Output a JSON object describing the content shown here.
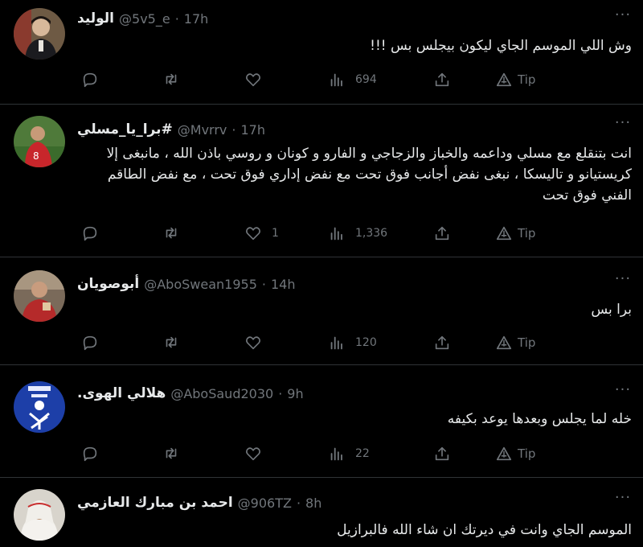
{
  "colors": {
    "background": "#000000",
    "text": "#e7e9ea",
    "muted": "#71767b",
    "divider": "#2f3336"
  },
  "icons": {
    "reply": "reply-icon",
    "retweet": "retweet-icon",
    "like": "like-icon",
    "views": "views-icon",
    "share": "share-icon",
    "tip": "tip-icon",
    "more": "more-icon"
  },
  "tweets": [
    {
      "name": "الوليد",
      "handle": "@5v5_e",
      "separator": "·",
      "time": "17h",
      "text": "وش اللي الموسم الجاي ليكون بيجلس بس !!!",
      "likes": "",
      "views": "694",
      "tip_label": "Tip"
    },
    {
      "name": "#برا_يا_مسلي",
      "handle": "@Mvrrv",
      "separator": "·",
      "time": "17h",
      "text": "انت بتنقلع مع مسلي وداعمه والخباز والزجاجي و الفارو و كونان و روسي باذن الله ، مانبغى إلا كريستيانو و تاليسكا ، نبغى نفض أجانب فوق تحت مع نفض إداري فوق تحت ، مع نفض الطاقم الفني فوق تحت",
      "likes": "1",
      "views": "1,336",
      "tip_label": "Tip"
    },
    {
      "name": "أبوصويان",
      "handle": "@AboSwean1955",
      "separator": "·",
      "time": "14h",
      "text": "برا بس",
      "likes": "",
      "views": "120",
      "tip_label": "Tip"
    },
    {
      "name": "هلالي الهوى.",
      "handle": "@AboSaud2030",
      "separator": "·",
      "time": "9h",
      "text": "خله لما يجلس وبعدها يوعد بكيفه",
      "likes": "",
      "views": "22",
      "tip_label": "Tip"
    },
    {
      "name": "احمد بن مبارك العازمي",
      "handle": "@906TZ",
      "separator": "·",
      "time": "8h",
      "text": "الموسم الجاي وانت في ديرتك ان شاء الله فالبرازيل",
      "likes": "",
      "views": "",
      "tip_label": ""
    }
  ]
}
